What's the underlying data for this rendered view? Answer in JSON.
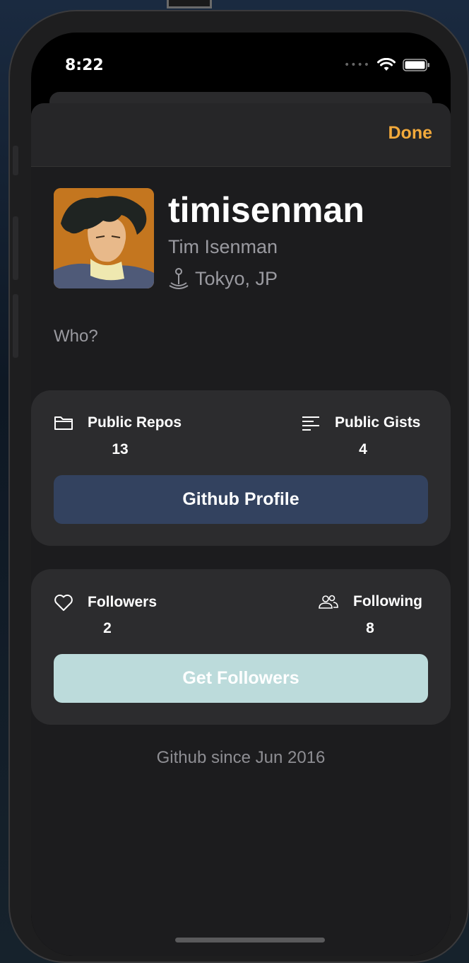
{
  "status_bar": {
    "time": "8:22"
  },
  "navbar": {
    "done_label": "Done"
  },
  "profile": {
    "username": "timisenman",
    "full_name": "Tim Isenman",
    "location": "Tokyo, JP",
    "bio": "Who?"
  },
  "repos_card": {
    "repos_label": "Public Repos",
    "repos_count": "13",
    "gists_label": "Public Gists",
    "gists_count": "4",
    "button_label": "Github Profile"
  },
  "followers_card": {
    "followers_label": "Followers",
    "followers_count": "2",
    "following_label": "Following",
    "following_count": "8",
    "button_label": "Get Followers"
  },
  "footer": {
    "since": "Github since Jun 2016"
  },
  "colors": {
    "accent": "#f2a93b",
    "github_button": "#33425f",
    "followers_button": "#bcdbdb"
  },
  "icons": {
    "repos": "folder-icon",
    "gists": "text-align-left-icon",
    "followers": "heart-icon",
    "following": "people-icon",
    "location": "mappin-icon"
  }
}
